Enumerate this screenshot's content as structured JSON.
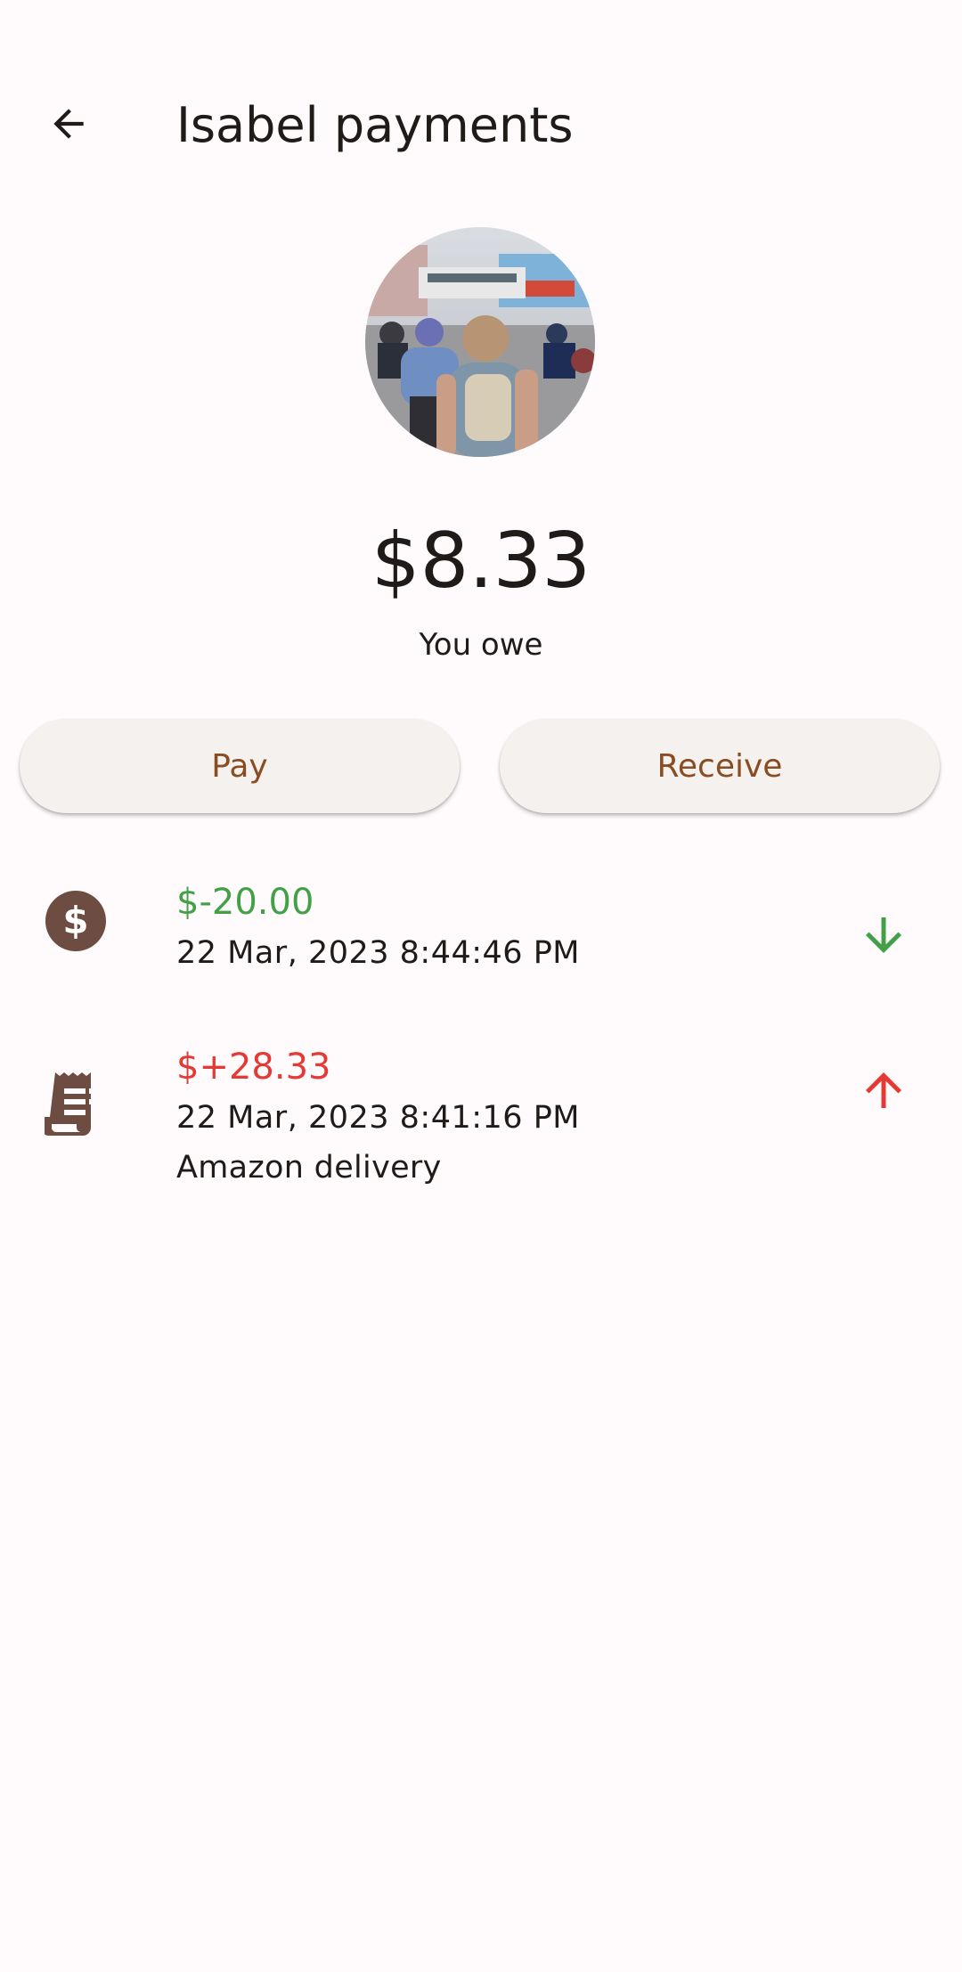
{
  "header": {
    "title": "Isabel payments",
    "back_icon": "arrow-back-icon"
  },
  "summary": {
    "avatar_icon": "contact-photo",
    "balance": "$8.33",
    "status": "You owe"
  },
  "actions": {
    "pay_label": "Pay",
    "receive_label": "Receive"
  },
  "transactions": [
    {
      "icon": "dollar-circle-icon",
      "amount": "$-20.00",
      "amount_color": "#43a047",
      "date": "22 Mar, 2023 8:44:46 PM",
      "note": "",
      "direction_icon": "arrow-down-icon"
    },
    {
      "icon": "receipt-icon",
      "amount": "$+28.33",
      "amount_color": "#e53935",
      "date": "22 Mar, 2023 8:41:16 PM",
      "note": "Amazon delivery",
      "direction_icon": "arrow-up-icon"
    }
  ],
  "colors": {
    "accent": "#8a4c22",
    "icon_brown": "#6d4c41",
    "button_bg": "#f5f1ee",
    "background": "#fffbfd"
  }
}
